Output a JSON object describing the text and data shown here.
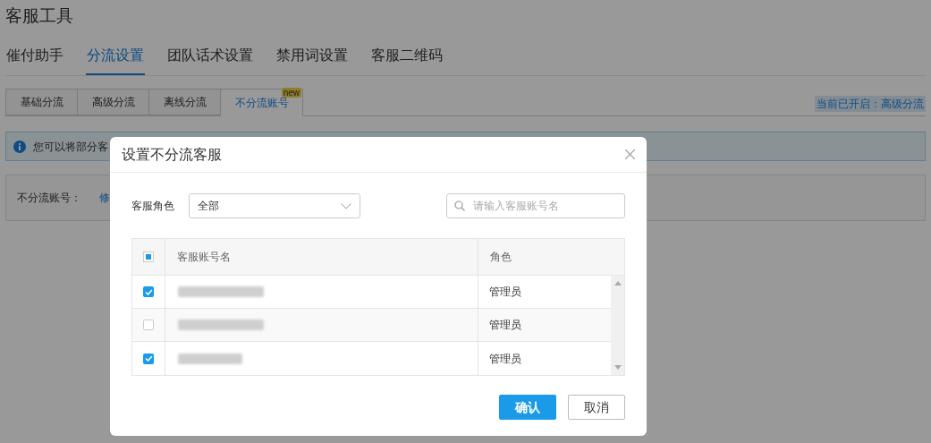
{
  "page": {
    "title": "客服工具"
  },
  "tabs": [
    {
      "label": "催付助手",
      "selected": false
    },
    {
      "label": "分流设置",
      "selected": true
    },
    {
      "label": "团队话术设置",
      "selected": false
    },
    {
      "label": "禁用词设置",
      "selected": false
    },
    {
      "label": "客服二维码",
      "selected": false
    }
  ],
  "sub_tabs": [
    {
      "label": "基础分流",
      "selected": false
    },
    {
      "label": "高级分流",
      "selected": false
    },
    {
      "label": "离线分流",
      "selected": false
    },
    {
      "label": "不分流账号",
      "selected": true,
      "badge": "new"
    }
  ],
  "current_mode": "当前已开启：高级分流",
  "info": "您可以将部分客",
  "panel": {
    "label": "不分流账号：",
    "link": "修"
  },
  "dialog": {
    "title": "设置不分流客服",
    "role_filter": {
      "label": "客服角色",
      "value": "全部"
    },
    "search": {
      "placeholder": "请输入客服账号名"
    },
    "table": {
      "select_all": {
        "indeterminate": true
      },
      "columns": [
        "客服账号名",
        "角色"
      ],
      "rows": [
        {
          "checked": true,
          "role": "管理员"
        },
        {
          "checked": false,
          "role": "管理员"
        },
        {
          "checked": true,
          "role": "管理员"
        }
      ]
    },
    "buttons": [
      {
        "label": "确认",
        "kind": "primary"
      },
      {
        "label": "取消",
        "kind": "secondary"
      }
    ]
  }
}
